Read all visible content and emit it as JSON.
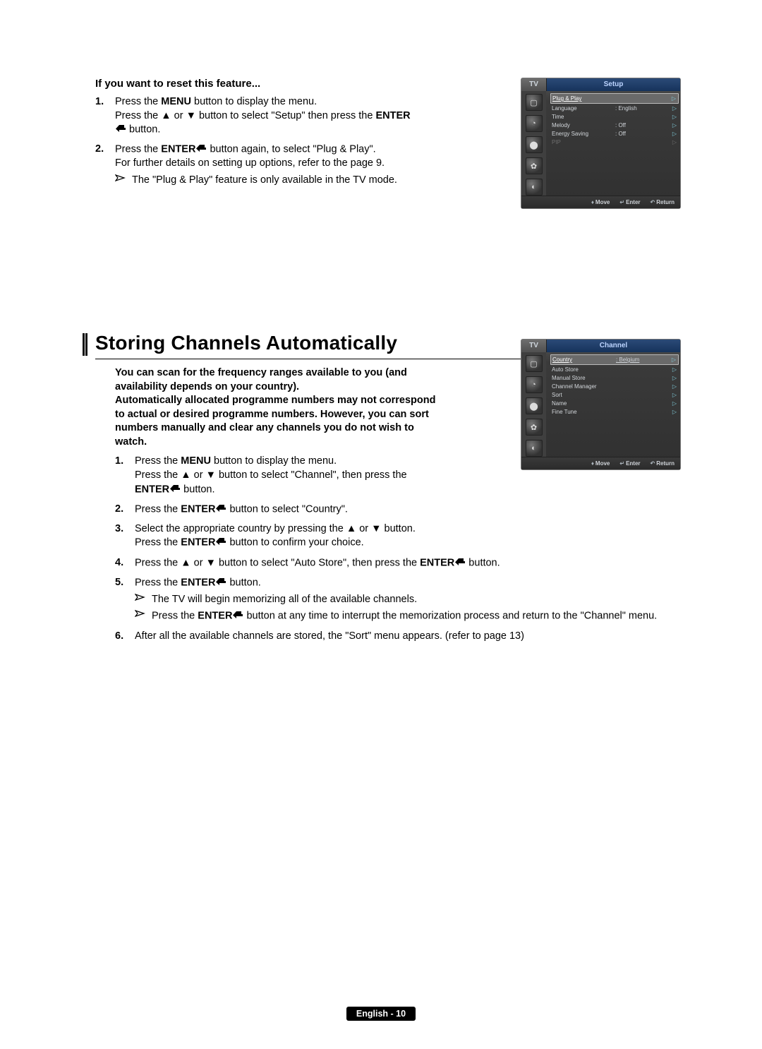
{
  "reset": {
    "title": "If you want to reset this feature...",
    "step1": {
      "num": "1.",
      "text_a": "Press the ",
      "b1": "MENU",
      "text_b": " button to display the menu.",
      "text_c": "Press the ▲ or ▼ button to select \"Setup\" then press the ",
      "b2": "ENTER",
      "text_d": " button."
    },
    "step2": {
      "num": "2.",
      "text_a": "Press the ",
      "b1": "ENTER",
      "text_b": " button again, to select \"Plug & Play\".",
      "text_c": "For further details on setting up options, refer to the page 9.",
      "note": "The \"Plug & Play\" feature is only available in the TV mode."
    }
  },
  "osd1": {
    "tv": "TV",
    "title": "Setup",
    "rows": [
      {
        "label": "Plug & Play",
        "value": "",
        "selected": true,
        "chev": "▷"
      },
      {
        "label": "Language",
        "value": ": English",
        "chev": "▷"
      },
      {
        "label": "Time",
        "value": "",
        "chev": "▷"
      },
      {
        "label": "Melody",
        "value": ": Off",
        "chev": "▷"
      },
      {
        "label": "Energy Saving",
        "value": ": Off",
        "chev": "▷"
      },
      {
        "label": "PIP",
        "value": "",
        "disabled": true,
        "chev": "▷"
      }
    ],
    "footer": {
      "move": "Move",
      "enter": "Enter",
      "return": "Return"
    }
  },
  "section2": {
    "title": "Storing Channels Automatically",
    "intro_a": "You can scan for the frequency ranges available to you (and availability depends on your country).",
    "intro_b": "Automatically allocated programme numbers may not correspond to actual or desired programme numbers. However, you can sort numbers manually and clear any channels you do not wish to watch.",
    "steps": {
      "s1": {
        "num": "1.",
        "a": "Press the ",
        "b": "MENU",
        "c": " button to display the menu.",
        "d": "Press the ▲ or ▼ button to select \"Channel\", then press the ",
        "e": "ENTER",
        "f": " button."
      },
      "s2": {
        "num": "2.",
        "a": "Press the ",
        "b": "ENTER",
        "c": " button to select \"Country\"."
      },
      "s3": {
        "num": "3.",
        "a": "Select the appropriate country by pressing the ▲ or ▼ button.",
        "b": "Press the ",
        "c": "ENTER",
        "d": " button to confirm your choice."
      },
      "s4": {
        "num": "4.",
        "a": "Press the ▲ or ▼ button to select \"Auto Store\", then press the ",
        "b": "ENTER",
        "c": " button."
      },
      "s5": {
        "num": "5.",
        "a": "Press the ",
        "b": "ENTER",
        "c": " button.",
        "note1": "The TV will begin memorizing all of the available channels.",
        "note2a": "Press the ",
        "note2b": "ENTER",
        "note2c": " button at any time to interrupt the memorization process and return to the \"Channel\" menu."
      },
      "s6": {
        "num": "6.",
        "a": "After all the available channels are stored, the \"Sort\" menu appears. (refer to page 13)"
      }
    }
  },
  "osd2": {
    "tv": "TV",
    "title": "Channel",
    "rows": [
      {
        "label": "Country",
        "value": ": Belgium",
        "selected": true,
        "chev": "▷"
      },
      {
        "label": "Auto Store",
        "value": "",
        "chev": "▷"
      },
      {
        "label": "Manual Store",
        "value": "",
        "chev": "▷"
      },
      {
        "label": "Channel Manager",
        "value": "",
        "chev": "▷"
      },
      {
        "label": "Sort",
        "value": "",
        "chev": "▷"
      },
      {
        "label": "Name",
        "value": "",
        "chev": "▷"
      },
      {
        "label": "Fine Tune",
        "value": "",
        "chev": "▷"
      }
    ],
    "footer": {
      "move": "Move",
      "enter": "Enter",
      "return": "Return"
    }
  },
  "footer": {
    "label": "English - 10"
  }
}
